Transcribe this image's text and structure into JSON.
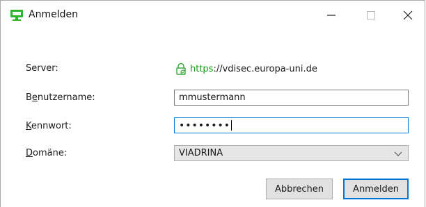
{
  "window": {
    "title": "Anmelden",
    "controls": {
      "minimize": "—",
      "maximize": "☐",
      "close": "✕"
    }
  },
  "form": {
    "server": {
      "label": "Server:",
      "scheme": "https",
      "rest": "://vdisec.europa-uni.de",
      "icon": "lock-icon"
    },
    "username": {
      "label_prefix": "B",
      "label_accel": "e",
      "label_suffix": "nutzername:",
      "value": "mmustermann"
    },
    "password": {
      "label_prefix": "",
      "label_accel": "K",
      "label_suffix": "ennwort:",
      "masked_value": "••••••••"
    },
    "domain": {
      "label_prefix": "",
      "label_accel": "D",
      "label_suffix": "omäne:",
      "selected": "VIADRINA",
      "icon": "chevron-down-icon"
    }
  },
  "buttons": {
    "cancel": "Abbrechen",
    "login": "Anmelden"
  },
  "colors": {
    "accent": "#0078d7",
    "secure": "#1a9a1a",
    "app_icon": "#2db52d"
  }
}
